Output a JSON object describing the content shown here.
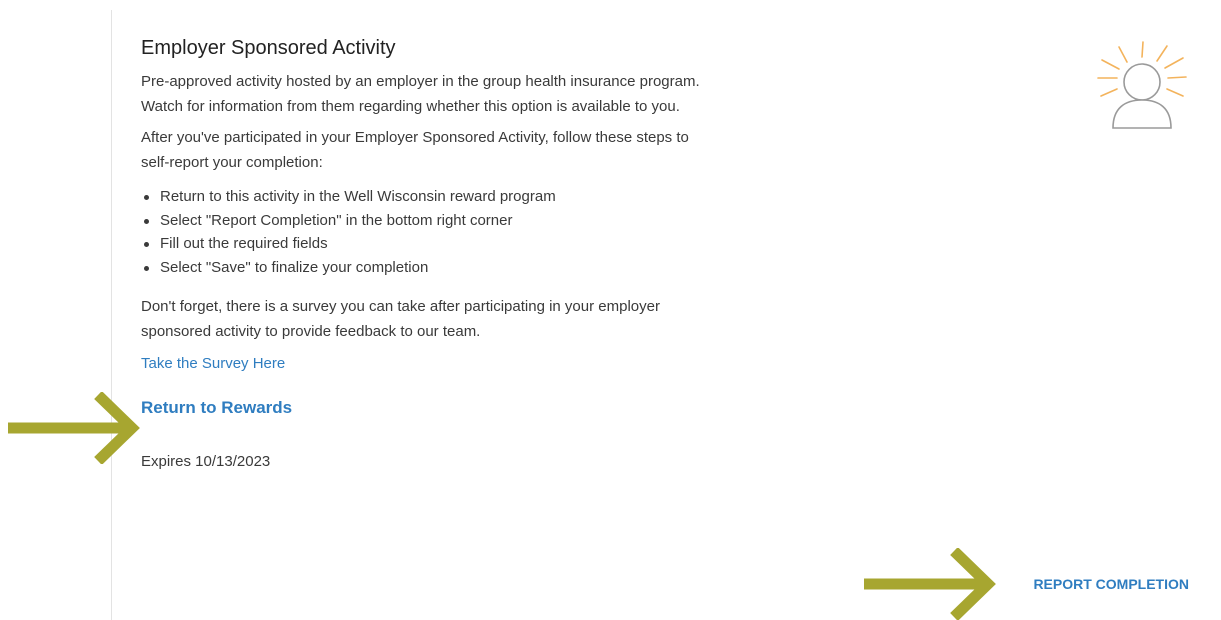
{
  "activity": {
    "title": "Employer Sponsored Activity",
    "description_line1": "Pre-approved activity hosted by an employer in the group health insurance program.",
    "description_line2": "Watch for information from them regarding whether this option is available to you.",
    "instructions_line1": "After you've participated in your Employer Sponsored Activity, follow these steps to",
    "instructions_line2": "self-report your completion:",
    "steps": [
      "Return to this activity in the Well Wisconsin reward program",
      "Select \"Report Completion\" in the bottom right corner",
      "Fill out the required fields",
      "Select \"Save\" to finalize your completion"
    ],
    "survey_note_line1": "Don't forget, there is a survey you can take after participating in your employer",
    "survey_note_line2": "sponsored activity to provide feedback to our team.",
    "survey_link_label": "Take the Survey Here",
    "return_link_label": "Return to Rewards",
    "expires_text": "Expires 10/13/2023",
    "report_completion_label": "REPORT COMPLETION"
  },
  "icons": {
    "activity_icon": "person-with-sunburst-icon",
    "pointer_arrow": "arrow-right-icon"
  },
  "colors": {
    "link": "#2f7dc0",
    "arrow": "#a7a630",
    "sun_rays": "#f3b35c",
    "person_outline": "#9a9a9a"
  }
}
